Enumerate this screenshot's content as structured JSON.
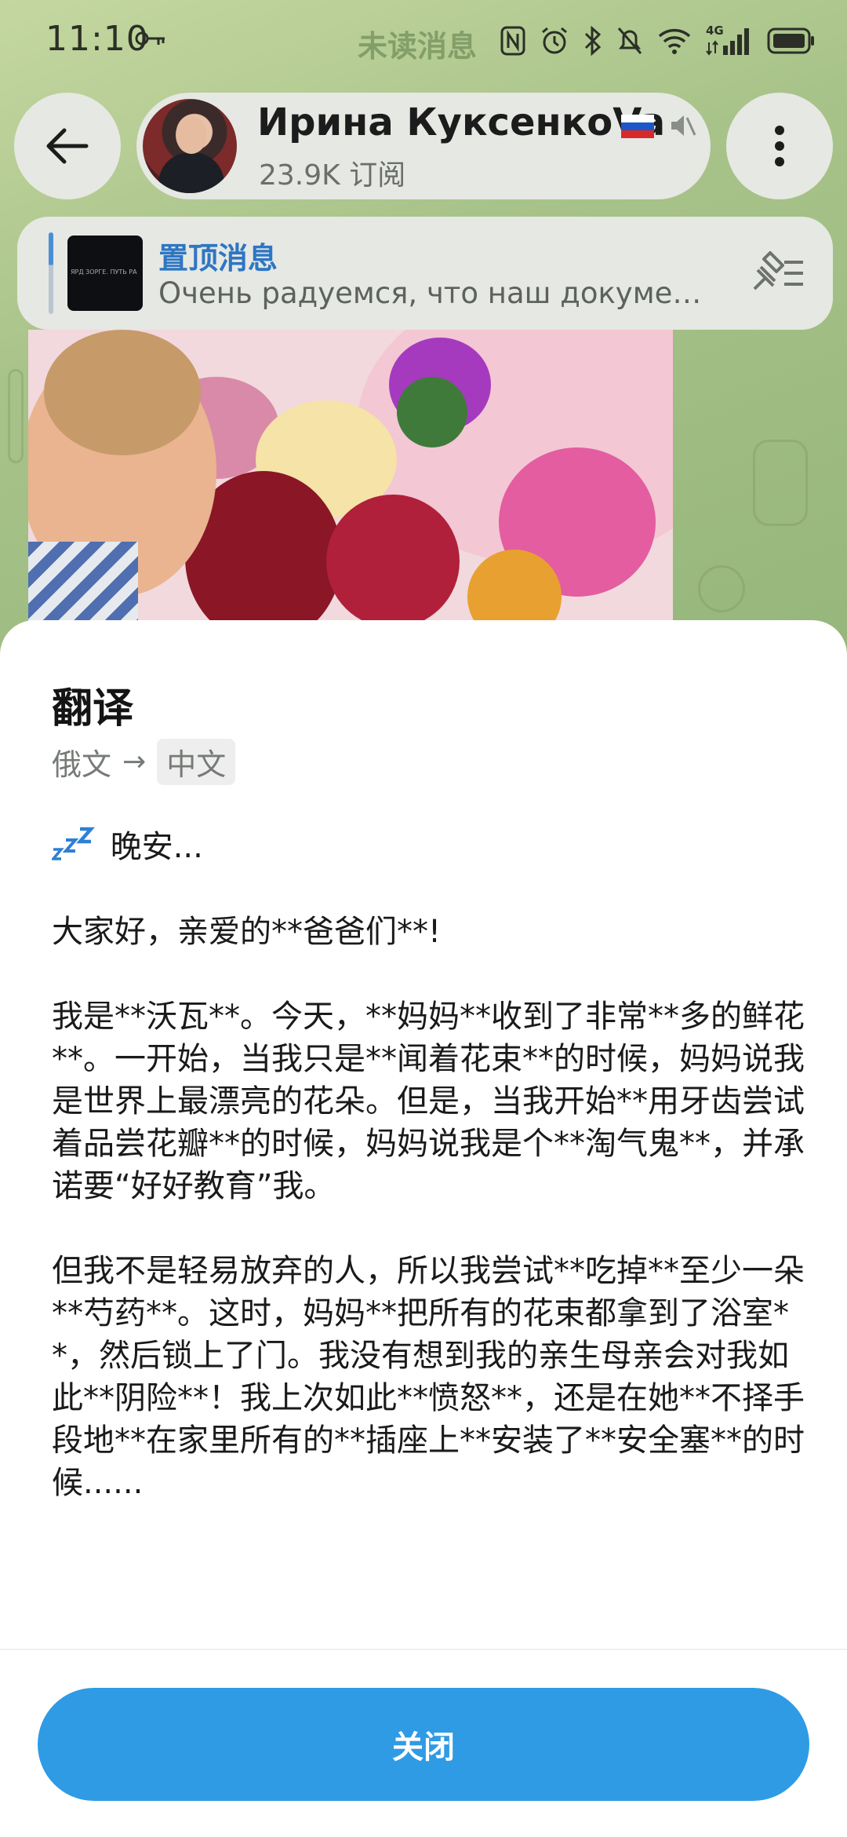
{
  "status_bar": {
    "time": "11:10",
    "unread_label": "未读消息",
    "network_label": "4G"
  },
  "header": {
    "channel_name": "Ирина КуксенкоVa",
    "subscribers": "23.9K 订阅",
    "flag": "russia-flag-icon"
  },
  "pinned": {
    "title": "置顶消息",
    "preview": "Очень радуемся, что наш докуме…",
    "thumb_text": "ЯРД ЗОРГЕ. ПУТЬ РА"
  },
  "translation": {
    "title": "翻译",
    "source_lang": "俄文",
    "target_lang": "中文",
    "paragraphs": [
      "晚安...",
      "大家好，亲爱的**爸爸们**!",
      "我是**沃瓦**。今天，**妈妈**收到了非常**多的鲜花**。一开始，当我只是**闻着花束**的时候，妈妈说我是世界上最漂亮的花朵。但是，当我开始**用牙齿尝试着品尝花瓣**的时候，妈妈说我是个**淘气鬼**，并承诺要“好好教育”我。",
      "但我不是轻易放弃的人，所以我尝试**吃掉**至少一朵**芍药**。这时，妈妈**把所有的花束都拿到了浴室**，然后锁上了门。我没有想到我的亲生母亲会对我如此**阴险**！我上次如此**愤怒**，还是在她**不择手段地**在家里所有的**插座上**安装了**安全塞**的时候......"
    ],
    "close_label": "关闭"
  },
  "colors": {
    "accent": "#2f9be4",
    "pinned_title": "#2d76c4"
  }
}
